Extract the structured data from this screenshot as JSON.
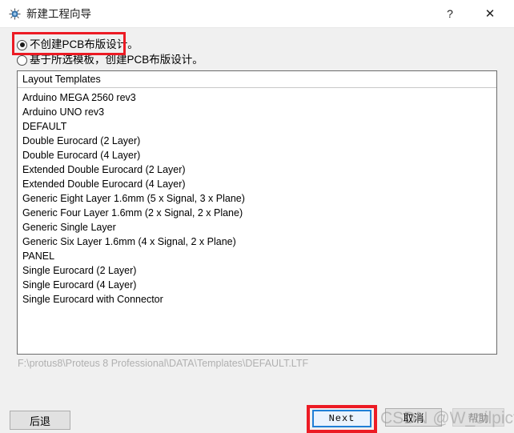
{
  "window": {
    "title": "新建工程向导",
    "icon": "proteus-app-icon",
    "help_label": "?",
    "close_label": "✕"
  },
  "options": {
    "radio_no_pcb": {
      "label": "不创建PCB布版设计。",
      "checked": true
    },
    "radio_from_template": {
      "label": "基于所选模板，创建PCB布版设计。",
      "checked": false
    }
  },
  "list": {
    "header": "Layout Templates",
    "items": [
      "Arduino MEGA 2560 rev3",
      "Arduino UNO rev3",
      "DEFAULT",
      "Double Eurocard (2 Layer)",
      "Double Eurocard (4 Layer)",
      "Extended Double Eurocard (2 Layer)",
      "Extended Double Eurocard (4 Layer)",
      "Generic Eight Layer 1.6mm (5 x Signal, 3 x Plane)",
      "Generic Four Layer 1.6mm (2 x Signal, 2 x Plane)",
      "Generic Single Layer",
      "Generic Six Layer 1.6mm (4 x Signal, 2 x Plane)",
      "PANEL",
      "Single Eurocard (2 Layer)",
      "Single Eurocard (4 Layer)",
      "Single Eurocard with Connector"
    ],
    "selected_path": "F:\\protus8\\Proteus 8 Professional\\DATA\\Templates\\DEFAULT.LTF"
  },
  "footer": {
    "back_label": "后退",
    "next_label": "Next",
    "cancel_label": "取消",
    "help_label": "帮助"
  },
  "annotations": {
    "highlight_color": "#ec1b24",
    "watermark": "CSDN @W_oilpicture"
  }
}
